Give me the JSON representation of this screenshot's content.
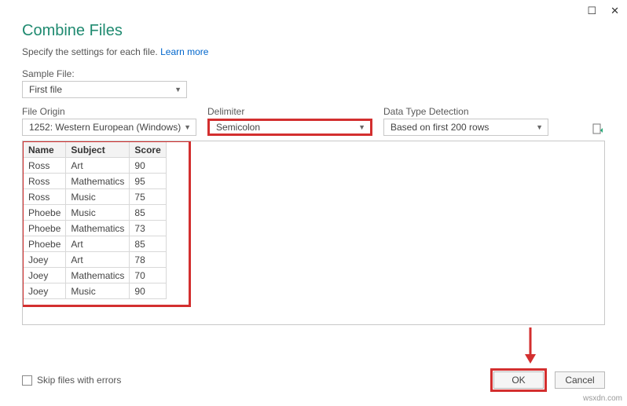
{
  "titlebar": {
    "maximize": "☐",
    "close": "✕"
  },
  "header": {
    "title": "Combine Files"
  },
  "subhead": {
    "text": "Specify the settings for each file. ",
    "link": "Learn more"
  },
  "sample": {
    "label": "Sample File:",
    "value": "First file"
  },
  "fileOrigin": {
    "label": "File Origin",
    "value": "1252: Western European (Windows)"
  },
  "delimiter": {
    "label": "Delimiter",
    "value": "Semicolon"
  },
  "dataType": {
    "label": "Data Type Detection",
    "value": "Based on first 200 rows"
  },
  "table": {
    "headers": [
      "Name",
      "Subject",
      "Score"
    ],
    "rows": [
      [
        "Ross",
        "Art",
        "90"
      ],
      [
        "Ross",
        "Mathematics",
        "95"
      ],
      [
        "Ross",
        "Music",
        "75"
      ],
      [
        "Phoebe",
        "Music",
        "85"
      ],
      [
        "Phoebe",
        "Mathematics",
        "73"
      ],
      [
        "Phoebe",
        "Art",
        "85"
      ],
      [
        "Joey",
        "Art",
        "78"
      ],
      [
        "Joey",
        "Mathematics",
        "70"
      ],
      [
        "Joey",
        "Music",
        "90"
      ]
    ]
  },
  "footer": {
    "skipErrors": "Skip files with errors",
    "ok": "OK",
    "cancel": "Cancel"
  },
  "watermark": "wsxdn.com"
}
